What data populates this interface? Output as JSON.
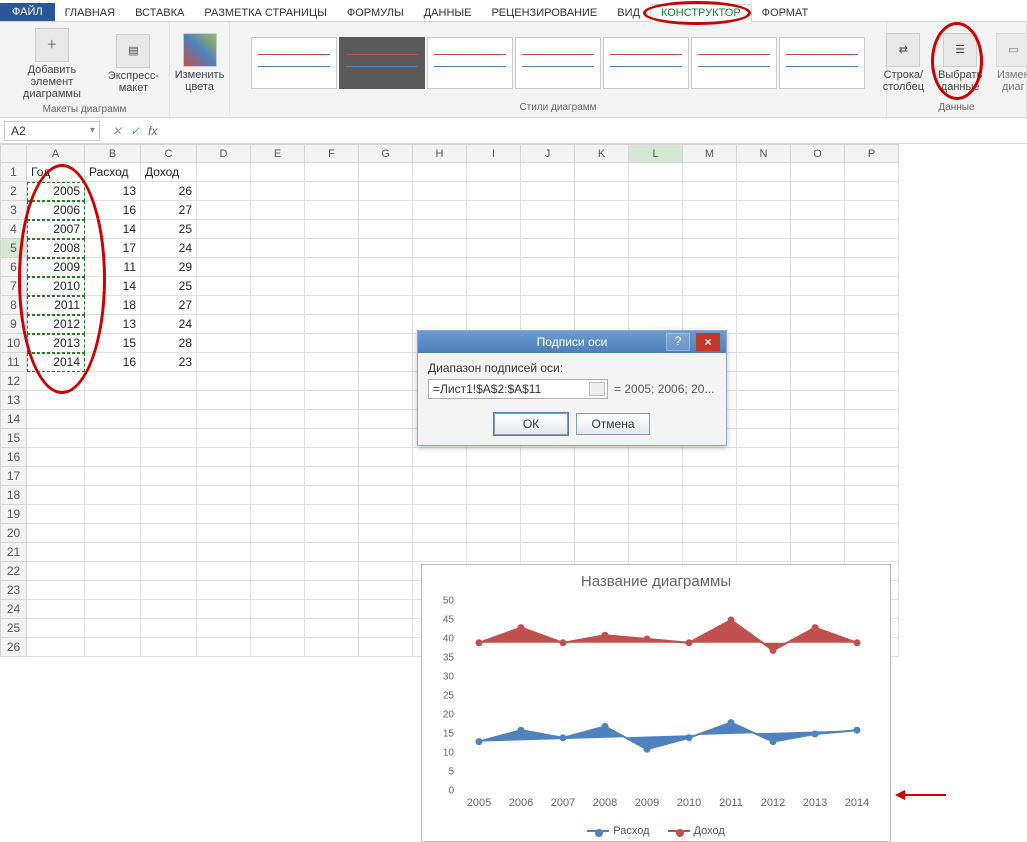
{
  "ribbon": {
    "tabs": [
      "ФАЙЛ",
      "ГЛАВНАЯ",
      "ВСТАВКА",
      "РАЗМЕТКА СТРАНИЦЫ",
      "ФОРМУЛЫ",
      "ДАННЫЕ",
      "РЕЦЕНЗИРОВАНИЕ",
      "ВИД",
      "КОНСТРУКТОР",
      "ФОРМАТ"
    ],
    "add_element": "Добавить элемент диаграммы",
    "express_layout": "Экспресс-макет",
    "change_colors": "Изменить цвета",
    "group_layouts": "Макеты диаграмм",
    "group_styles": "Стили диаграмм",
    "switch_rowcol": "Строка/столбец",
    "select_data": "Выбрать данные",
    "change_type": "Измен диаг",
    "group_data": "Данные"
  },
  "fbar": {
    "name": "A2",
    "fx_cancel": "✕",
    "fx_ok": "✓",
    "fx": "fx"
  },
  "columns": [
    "A",
    "B",
    "C",
    "D",
    "E",
    "F",
    "G",
    "H",
    "I",
    "J",
    "K",
    "L",
    "M",
    "N",
    "O",
    "P"
  ],
  "headers": {
    "A": "Год",
    "B": "Расход",
    "C": "Доход"
  },
  "rows": [
    {
      "r": 1,
      "A": "Год",
      "B": "Расход",
      "C": "Доход",
      "text": true
    },
    {
      "r": 2,
      "A": "2005",
      "B": "13",
      "C": "26"
    },
    {
      "r": 3,
      "A": "2006",
      "B": "16",
      "C": "27"
    },
    {
      "r": 4,
      "A": "2007",
      "B": "14",
      "C": "25"
    },
    {
      "r": 5,
      "A": "2008",
      "B": "17",
      "C": "24"
    },
    {
      "r": 6,
      "A": "2009",
      "B": "11",
      "C": "29"
    },
    {
      "r": 7,
      "A": "2010",
      "B": "14",
      "C": "25"
    },
    {
      "r": 8,
      "A": "2011",
      "B": "18",
      "C": "27"
    },
    {
      "r": 9,
      "A": "2012",
      "B": "13",
      "C": "24"
    },
    {
      "r": 10,
      "A": "2013",
      "B": "15",
      "C": "28"
    },
    {
      "r": 11,
      "A": "2014",
      "B": "16",
      "C": "23"
    }
  ],
  "dialog": {
    "title": "Подписи оси",
    "label": "Диапазон подписей оси:",
    "value": "=Лист1!$A$2:$A$11",
    "preview": "= 2005; 2006; 20...",
    "ok": "ОК",
    "cancel": "Отмена"
  },
  "chart_data": {
    "type": "line",
    "title": "Название диаграммы",
    "xlabel": "",
    "ylabel": "",
    "categories": [
      "2005",
      "2006",
      "2007",
      "2008",
      "2009",
      "2010",
      "2011",
      "2012",
      "2013",
      "2014"
    ],
    "series": [
      {
        "name": "Расход",
        "color": "#4f81bd",
        "values": [
          13,
          16,
          14,
          17,
          11,
          14,
          18,
          13,
          15,
          16
        ]
      },
      {
        "name": "Доход",
        "color": "#c0504d",
        "values": [
          39,
          43,
          39,
          41,
          40,
          39,
          45,
          37,
          43,
          39
        ]
      }
    ],
    "ylim": [
      0,
      50
    ],
    "yticks": [
      0,
      5,
      10,
      15,
      20,
      25,
      30,
      35,
      40,
      45,
      50
    ]
  }
}
